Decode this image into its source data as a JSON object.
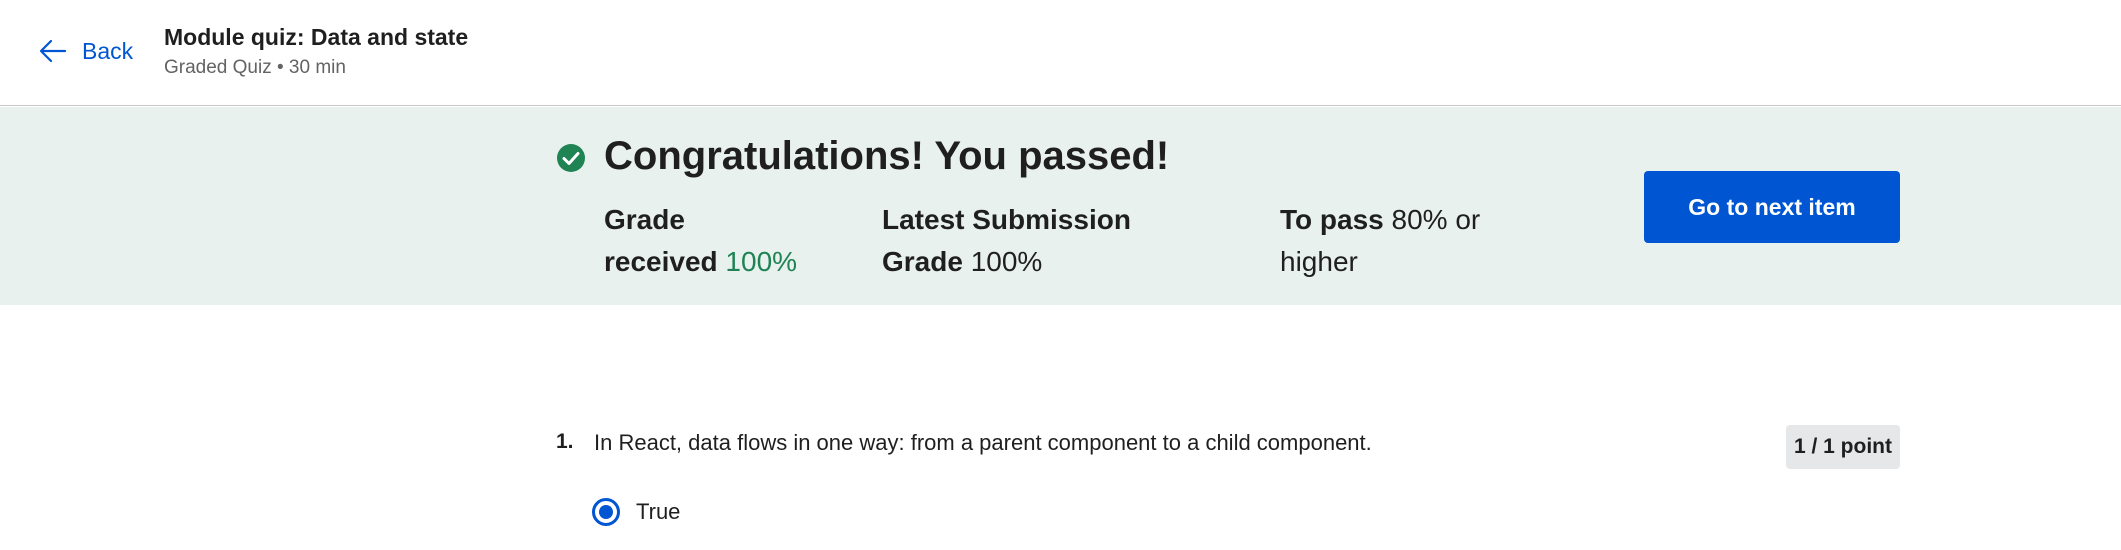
{
  "header": {
    "back_label": "Back",
    "title": "Module quiz: Data and state",
    "subtitle": "Graded Quiz • 30 min"
  },
  "banner": {
    "heading": "Congratulations! You passed!",
    "grade_received_label_1": "Grade",
    "grade_received_label_2": "received",
    "grade_received_value": "100%",
    "latest_label_1": "Latest Submission",
    "latest_label_2": "Grade",
    "latest_value": "100%",
    "to_pass_label": "To pass",
    "to_pass_value_1": "80% or",
    "to_pass_value_2": "higher",
    "next_button": "Go to next item",
    "colors": {
      "background": "#e8f1ee",
      "success": "#1f8354",
      "accent": "#0056d2"
    }
  },
  "questions": [
    {
      "number": "1.",
      "text": "In React, data flows in one way: from a parent component to a child component.",
      "points": "1 / 1 point",
      "selected_option": "True"
    }
  ]
}
